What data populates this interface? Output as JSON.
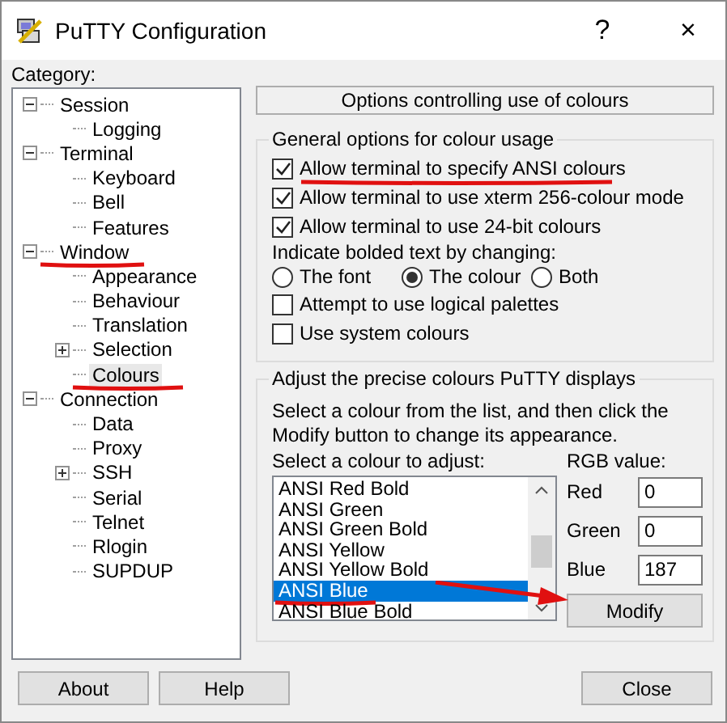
{
  "window": {
    "title": "PuTTY Configuration",
    "help_button": "?",
    "close_button": "×"
  },
  "category_label": "Category:",
  "tree": [
    {
      "label": "Session",
      "expanded": true,
      "selected": false,
      "children": [
        {
          "label": "Logging",
          "selected": false
        }
      ]
    },
    {
      "label": "Terminal",
      "expanded": true,
      "selected": false,
      "children": [
        {
          "label": "Keyboard",
          "selected": false
        },
        {
          "label": "Bell",
          "selected": false
        },
        {
          "label": "Features",
          "selected": false
        }
      ]
    },
    {
      "label": "Window",
      "expanded": true,
      "selected": false,
      "underlined": true,
      "children": [
        {
          "label": "Appearance",
          "selected": false
        },
        {
          "label": "Behaviour",
          "selected": false
        },
        {
          "label": "Translation",
          "selected": false
        },
        {
          "label": "Selection",
          "expanded": false,
          "selected": false
        },
        {
          "label": "Colours",
          "selected": true,
          "underlined": true
        }
      ]
    },
    {
      "label": "Connection",
      "expanded": true,
      "selected": false,
      "children": [
        {
          "label": "Data",
          "selected": false
        },
        {
          "label": "Proxy",
          "selected": false
        },
        {
          "label": "SSH",
          "expanded": false,
          "selected": false
        },
        {
          "label": "Serial",
          "selected": false
        },
        {
          "label": "Telnet",
          "selected": false
        },
        {
          "label": "Rlogin",
          "selected": false
        },
        {
          "label": "SUPDUP",
          "selected": false
        }
      ]
    }
  ],
  "panel_header": "Options controlling use of colours",
  "general_group": {
    "legend": "General options for colour usage",
    "checkboxes": [
      {
        "label": "Allow terminal to specify ANSI colours",
        "checked": true,
        "underlined": true
      },
      {
        "label": "Allow terminal to use xterm 256-colour mode",
        "checked": true
      },
      {
        "label": "Allow terminal to use 24-bit colours",
        "checked": true
      }
    ],
    "bold_label": "Indicate bolded text by changing:",
    "radios": [
      {
        "label": "The font",
        "selected": false
      },
      {
        "label": "The colour",
        "selected": true
      },
      {
        "label": "Both",
        "selected": false
      }
    ],
    "more_checkboxes": [
      {
        "label": "Attempt to use logical palettes",
        "checked": false
      },
      {
        "label": "Use system colours",
        "checked": false
      }
    ]
  },
  "adjust_group": {
    "legend": "Adjust the precise colours PuTTY displays",
    "description": "Select a colour from the list, and then click the Modify button to change its appearance.",
    "list_label": "Select a colour to adjust:",
    "colours": [
      {
        "label": "ANSI Red Bold",
        "selected": false
      },
      {
        "label": "ANSI Green",
        "selected": false
      },
      {
        "label": "ANSI Green Bold",
        "selected": false
      },
      {
        "label": "ANSI Yellow",
        "selected": false
      },
      {
        "label": "ANSI Yellow Bold",
        "selected": false
      },
      {
        "label": "ANSI Blue",
        "selected": true,
        "underlined": true
      },
      {
        "label": "ANSI Blue Bold",
        "selected": false
      }
    ],
    "rgb_label": "RGB value:",
    "rgb": [
      {
        "label": "Red",
        "value": "0"
      },
      {
        "label": "Green",
        "value": "0"
      },
      {
        "label": "Blue",
        "value": "187"
      }
    ],
    "modify_button": "Modify",
    "arrow_to_modify": true
  },
  "buttons": [
    {
      "label": "About",
      "kind": "left"
    },
    {
      "label": "Help",
      "kind": "left"
    },
    {
      "label": "Close",
      "kind": "right"
    }
  ]
}
